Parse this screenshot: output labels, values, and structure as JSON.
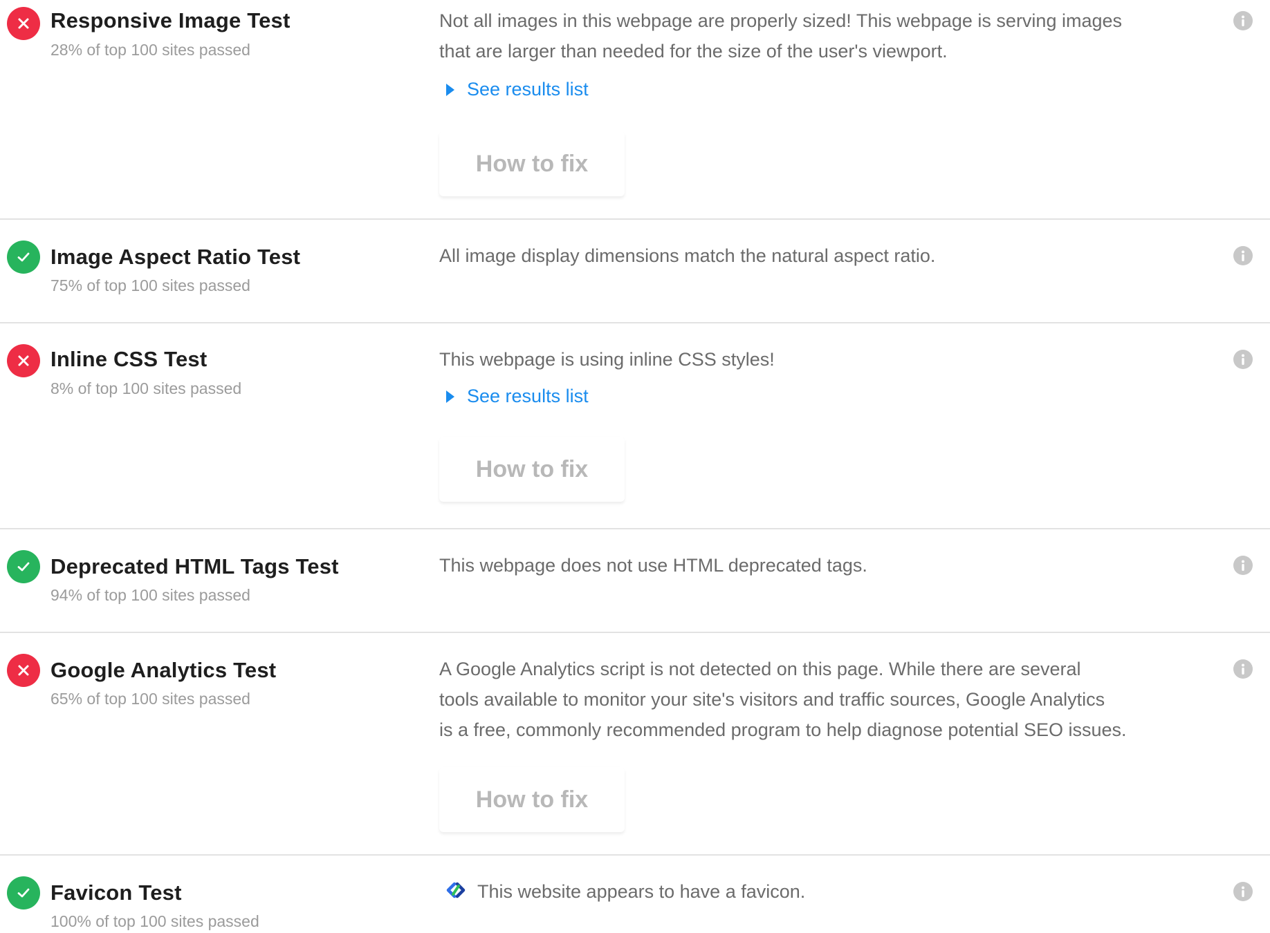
{
  "common": {
    "see_results_label": "See results list",
    "how_to_fix_label": "How to fix"
  },
  "colors": {
    "fail": "#ee2d45",
    "pass": "#27b45d",
    "link": "#1a8cee"
  },
  "tests": [
    {
      "status": "fail",
      "title": "Responsive Image Test",
      "subtitle": "28% of top 100 sites passed",
      "description": [
        "Not all images in this webpage are properly sized! This webpage is serving images",
        "that are larger than needed for the size of the user's viewport."
      ]
    },
    {
      "status": "pass",
      "title": "Image Aspect Ratio Test",
      "subtitle": "75% of top 100 sites passed",
      "description": [
        "All image display dimensions match the natural aspect ratio."
      ]
    },
    {
      "status": "fail",
      "title": "Inline CSS Test",
      "subtitle": "8% of top 100 sites passed",
      "description": [
        "This webpage is using inline CSS styles!"
      ]
    },
    {
      "status": "pass",
      "title": "Deprecated HTML Tags Test",
      "subtitle": "94% of top 100 sites passed",
      "description": [
        "This webpage does not use HTML deprecated tags."
      ]
    },
    {
      "status": "fail",
      "title": "Google Analytics Test",
      "subtitle": "65% of top 100 sites passed",
      "description": [
        "A Google Analytics script is not detected on this page. While there are several",
        "tools available to monitor your site's visitors and traffic sources, Google Analytics",
        "is a free, commonly recommended program to help diagnose potential SEO issues."
      ]
    },
    {
      "status": "pass",
      "title": "Favicon Test",
      "subtitle": "100% of top 100 sites passed",
      "description": [
        "This website appears to have a favicon."
      ]
    }
  ]
}
